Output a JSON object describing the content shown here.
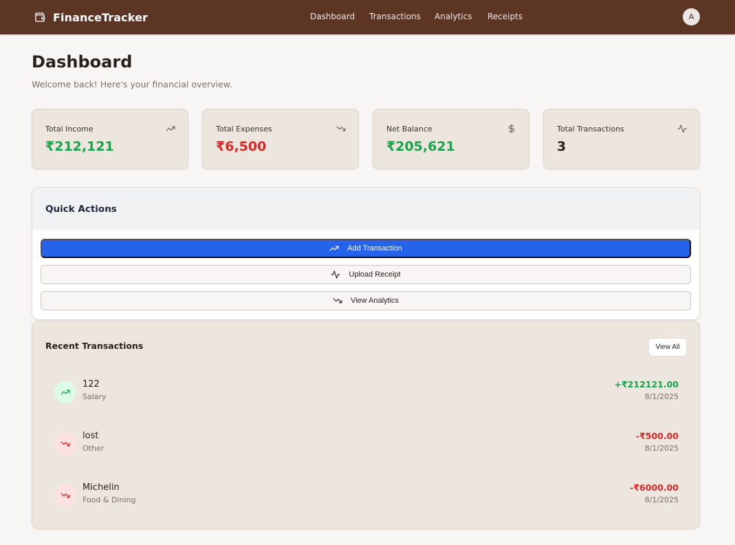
{
  "app": {
    "name": "FinanceTracker",
    "brand_icon": "wallet-icon",
    "nav": [
      "Dashboard",
      "Transactions",
      "Analytics",
      "Receipts"
    ],
    "avatar_initial": "A"
  },
  "page": {
    "title": "Dashboard",
    "subtitle": "Welcome back! Here's your financial overview."
  },
  "stats": [
    {
      "label": "Total Income",
      "value": "₹212,121",
      "icon": "trending-up-icon",
      "tone": "green"
    },
    {
      "label": "Total Expenses",
      "value": "₹6,500",
      "icon": "trending-down-icon",
      "tone": "red"
    },
    {
      "label": "Net Balance",
      "value": "₹205,621",
      "icon": "dollar-icon",
      "tone": "green"
    },
    {
      "label": "Total Transactions",
      "value": "3",
      "icon": "activity-icon",
      "tone": "dark"
    }
  ],
  "quick_actions": {
    "title": "Quick Actions",
    "buttons": [
      {
        "label": "Add Transaction",
        "icon": "trending-up-icon"
      },
      {
        "label": "Upload Receipt",
        "icon": "activity-icon"
      },
      {
        "label": "View Analytics",
        "icon": "trending-down-icon"
      }
    ]
  },
  "recent_transactions": {
    "title": "Recent Transactions",
    "view_all": "View All",
    "items": [
      {
        "name": "122",
        "category": "Salary",
        "amount": "+₹212121.00",
        "date": "8/1/2025",
        "type": "income"
      },
      {
        "name": "lost",
        "category": "Other",
        "amount": "-₹500.00",
        "date": "8/1/2025",
        "type": "expense"
      },
      {
        "name": "Michelin",
        "category": "Food & Dining",
        "amount": "-₹6000.00",
        "date": "8/1/2025",
        "type": "expense"
      }
    ]
  },
  "colors": {
    "header": "#5d3525",
    "income": "#16a34a",
    "expense": "#dc2626",
    "primary": "#2563eb",
    "card": "#ece6df",
    "background": "#f8f6f4"
  }
}
